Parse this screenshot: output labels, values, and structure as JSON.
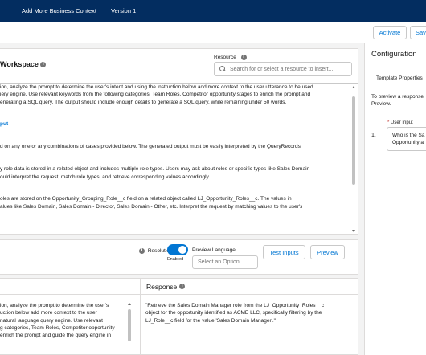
{
  "topbar": {
    "app_title": "Add More Business Context",
    "version": "Version 1"
  },
  "actions": {
    "activate_label": "Activate",
    "save_label": "Sav"
  },
  "workspace": {
    "title": "Workspace",
    "info_glyph": "i",
    "resource_label": "Resource",
    "resource_placeholder": "Search for or select a resource to insert...",
    "prompt_lines": [
      "ion, analyze the prompt to determine the user's intent and using the instruction below add more context to the user utterance to be used",
      "iery engine. Use relevant keywords from the following categories, Team Roles, Competitor opportunity stages to enrich the prompt and",
      "enerating a SQL query. The output should include enough details to generate a SQL query, while remaining under 50 words.",
      "",
      "",
      "put",
      "",
      "",
      "d on any one or any combinations of cases provided below. The generated output must be easily interpreted by the QueryRecords",
      "",
      "",
      "y role data is stored in a related object and includes multiple role types. Users may ask about roles or specific types like Sales Domain",
      "ould interpret the request, match role types, and retrieve corresponding values accordingly.",
      "",
      "",
      "oles are stored on the Opportunity_Grouping_Role__c field on a related object called LJ_Opportunity_Roles__c. The values in",
      "alues like Sales Domain, Sales Domain - Director, Sales Domain - Other, etc. Interpret the request by matching values to the user's"
    ]
  },
  "preview_bar": {
    "resolution_label": "Resolution",
    "toggle_state": "Enabled",
    "preview_language_label": "Preview Language",
    "language_placeholder": "Select an Option",
    "test_inputs_label": "Test Inputs",
    "preview_label": "Preview"
  },
  "resolution_panel": {
    "lines": [
      "ion, analyze the prompt to determine the user's",
      "uction below add more context to the user",
      "natural language query engine. Use relevant",
      "g categories, Team Roles, Competitor opportunity",
      "enrich the prompt and guide the query engine in"
    ]
  },
  "response_panel": {
    "title": "Response",
    "lines": [
      "\"Retrieve the Sales Domain Manager role from the LJ_Opportunity_Roles__c",
      "object for the opportunity identified as ACME LLC, specifically filtering by the",
      "LJ_Role__c field for the value 'Sales Domain Manager'.\""
    ]
  },
  "configuration": {
    "title": "Configuration",
    "tab_label": "Template Properties",
    "desc_line1": "To preview a response",
    "desc_line2": "Preview.",
    "required_mark": "*",
    "user_input_label": "User Input",
    "item_number": "1.",
    "user_input_line1": "Who is the Sa",
    "user_input_line2": "Opportunity a"
  },
  "colors": {
    "topbar": "#032d60",
    "brand_blue": "#0176d3",
    "border": "#dddbda"
  }
}
